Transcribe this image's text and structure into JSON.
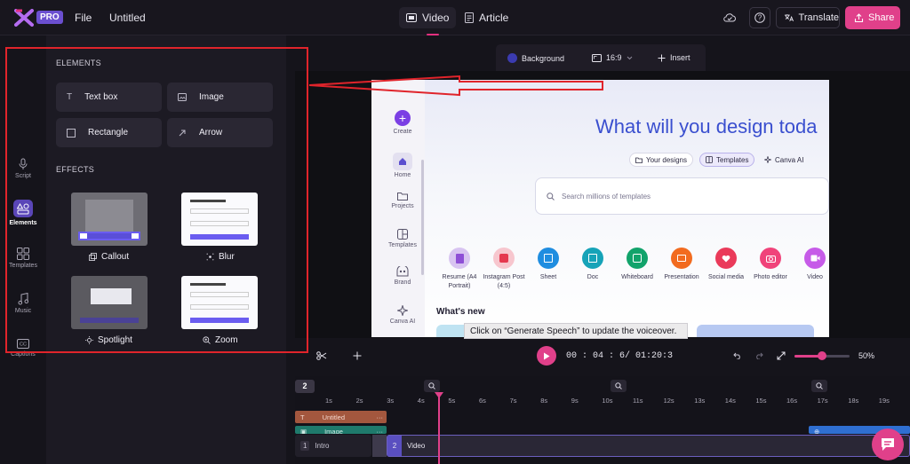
{
  "topbar": {
    "pro_badge": "PRO",
    "file_label": "File",
    "doc_title": "Untitled",
    "tabs": [
      {
        "label": "Video"
      },
      {
        "label": "Article"
      }
    ],
    "translate_label": "Translate",
    "share_label": "Share"
  },
  "rail": {
    "items": [
      {
        "label": "Script",
        "icon": "microphone-icon"
      },
      {
        "label": "Elements",
        "icon": "shapes-icon"
      },
      {
        "label": "Templates",
        "icon": "grid-icon"
      },
      {
        "label": "Music",
        "icon": "music-note-icon"
      },
      {
        "label": "Captions",
        "icon": "captions-icon"
      }
    ]
  },
  "panel": {
    "elements_title": "ELEMENTS",
    "elements": [
      {
        "label": "Text box",
        "icon": "text-icon"
      },
      {
        "label": "Image",
        "icon": "image-icon"
      },
      {
        "label": "Rectangle",
        "icon": "square-icon"
      },
      {
        "label": "Arrow",
        "icon": "arrow-icon"
      }
    ],
    "effects_title": "EFFECTS",
    "effects": [
      {
        "label": "Callout",
        "icon": "callout-icon"
      },
      {
        "label": "Blur",
        "icon": "blur-icon"
      },
      {
        "label": "Spotlight",
        "icon": "spotlight-icon"
      },
      {
        "label": "Zoom",
        "icon": "zoom-icon"
      }
    ]
  },
  "canvas_toolbar": {
    "background_label": "Background",
    "ratio_label": "16:9",
    "insert_label": "Insert"
  },
  "screenshot": {
    "sidebar": [
      {
        "label": "Create"
      },
      {
        "label": "Home"
      },
      {
        "label": "Projects"
      },
      {
        "label": "Templates"
      },
      {
        "label": "Brand"
      },
      {
        "label": "Canva AI"
      }
    ],
    "hero_title": "What will you design toda",
    "pills": [
      {
        "label": "Your designs"
      },
      {
        "label": "Templates"
      },
      {
        "label": "Canva AI"
      }
    ],
    "search_placeholder": "Search millions of templates",
    "categories": [
      {
        "label": "Resume (A4 Portrait)",
        "color": "#c9a6e8"
      },
      {
        "label": "Instagram Post (4:5)",
        "color": "#f3a7b5"
      },
      {
        "label": "Sheet",
        "color": "#1f8de0"
      },
      {
        "label": "Doc",
        "color": "#16a3b8"
      },
      {
        "label": "Whiteboard",
        "color": "#12a36b"
      },
      {
        "label": "Presentation",
        "color": "#f26b1f"
      },
      {
        "label": "Social media",
        "color": "#ea3a5a"
      },
      {
        "label": "Photo editor",
        "color": "#f0437a"
      },
      {
        "label": "Video",
        "color": "#c65be8"
      }
    ],
    "whats_new": "What's new"
  },
  "tooltip": "Click on “Generate Speech” to update the voiceover.",
  "playback": {
    "current_time": "00 : 04 :  6",
    "total_time": "/  01:20:3",
    "zoom_percent": "50%",
    "zoom_level": 0.5
  },
  "timeline": {
    "scene_badge": "2",
    "ticks": [
      "1s",
      "2s",
      "3s",
      "4s",
      "5s",
      "6s",
      "7s",
      "8s",
      "9s",
      "10s",
      "11s",
      "12s",
      "13s",
      "14s",
      "15s",
      "16s",
      "17s",
      "18s",
      "19s"
    ],
    "tracks": [
      {
        "label": "Untitled"
      },
      {
        "label": "Image"
      },
      {
        "label": "Zo"
      }
    ],
    "scenes": [
      {
        "index": "1",
        "label": "Intro"
      },
      {
        "index": "2",
        "label": "Video"
      }
    ]
  },
  "colors": {
    "accent": "#e0408a",
    "selection": "#5a46b8",
    "annotation": "#e0242b"
  }
}
